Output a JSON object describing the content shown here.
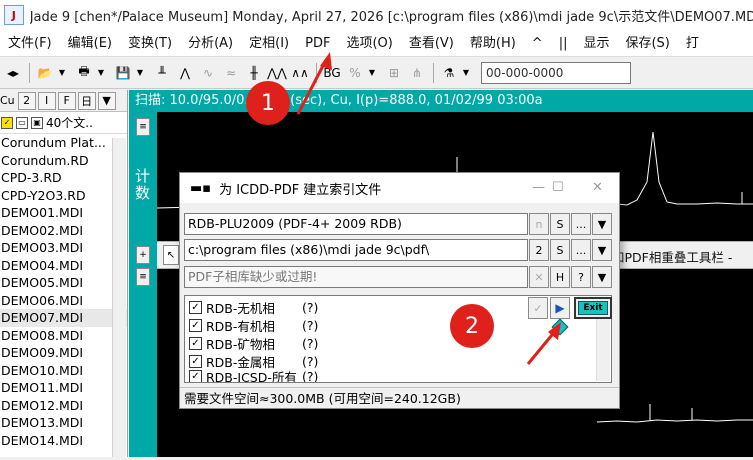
{
  "window": {
    "title": "Jade 9 [chen*/Palace Museum] Monday, April 27, 2026 [c:\\program files (x86)\\mdi jade 9c\\示范文件\\DEMO07.MDI]"
  },
  "menu": {
    "items": [
      "文件(F)",
      "编辑(E)",
      "变换(T)",
      "分析(A)",
      "定相(I)",
      "PDF",
      "选项(O)",
      "查看(V)",
      "帮助(H)",
      "^",
      "||",
      "显示",
      "保存(S)",
      "打"
    ]
  },
  "toolbar": {
    "pattern_input": "00-000-0000"
  },
  "left_panel": {
    "element_label": "Cu",
    "btn_2": "2",
    "btn_i": "I",
    "btn_f": "F",
    "btn_grid": "日",
    "file_count": "40个文..",
    "files": [
      "Corundum Plat...",
      "Corundum.RD",
      "CPD-3.RD",
      "CPD-Y2O3.RD",
      "DEMO01.MDI",
      "DEMO02.MDI",
      "DEMO03.MDI",
      "DEMO04.MDI",
      "DEMO05.MDI",
      "DEMO06.MDI",
      "DEMO07.MDI",
      "DEMO08.MDI",
      "DEMO09.MDI",
      "DEMO10.MDI",
      "DEMO11.MDI",
      "DEMO12.MDI",
      "DEMO13.MDI",
      "DEMO14.MDI"
    ],
    "selected_index": 10
  },
  "chart": {
    "header": "扫描: 10.0/95.0/0.02/0.1(sec), Cu, I(p)=888.0, 01/02/99 03:00a",
    "y_label": "计数",
    "overlay_toolbar_text": "和PDF相重叠工具栏 -"
  },
  "dialog": {
    "title": "为 ICDD-PDF 建立索引文件",
    "database": "RDB-PLU2009 (PDF-4+ 2009 RDB)",
    "path": "c:\\program files (x86)\\mdi jade 9c\\pdf\\",
    "status_msg": "PDF子相库缺少或过期!",
    "btn_n": "n",
    "btn_s": "S",
    "btn_dots": "...",
    "btn_h": "H",
    "btn_q": "?",
    "exit_label": "Exit",
    "subsets": [
      {
        "name": "RDB-无机相",
        "q": "(?)",
        "checked": true
      },
      {
        "name": "RDB-有机相",
        "q": "(?)",
        "checked": true
      },
      {
        "name": "RDB-矿物相",
        "q": "(?)",
        "checked": true
      },
      {
        "name": "RDB-金属相",
        "q": "(?)",
        "checked": true
      },
      {
        "name": "RDB-ICSD-所有",
        "q": "(?)",
        "checked": true
      }
    ],
    "footer": "需要文件空间≈300.0MB (可用空间=240.12GB)"
  },
  "annotations": {
    "badge1": "1",
    "badge2": "2",
    "color": "#e0201a"
  },
  "colors": {
    "accent": "#00a8a8",
    "chart_bg": "#000000",
    "exit_btn": "#19c0c0"
  }
}
